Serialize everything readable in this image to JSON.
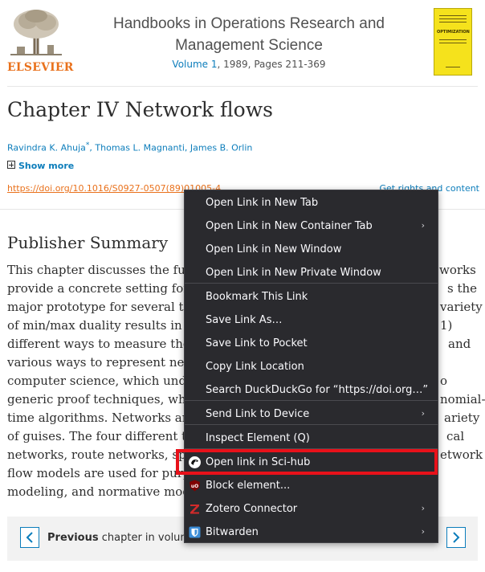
{
  "header": {
    "publisher": "ELSEVIER",
    "journal_line1": "Handbooks in Operations Research and",
    "journal_line2": "Management Science",
    "volume_link": "Volume 1",
    "volume_rest": ", 1989, Pages 211-369",
    "cover_title": "OPTIMIZATION"
  },
  "article": {
    "title": "Chapter IV Network flows",
    "author1": "Ravindra K. Ahuja",
    "author1_mark": "*",
    "authors_rest": ", Thomas L. Magnanti, James B. Orlin",
    "show_more": "Show more",
    "doi": "https://doi.org/10.1016/S0927-0507(89)01005-4",
    "rights": "Get rights and content"
  },
  "summary": {
    "heading": "Publisher Summary",
    "lines_left": [
      "This chapter discusses the fund",
      "provide a concrete setting for te",
      "major prototype for several theo",
      "of min/max duality results in di",
      "different ways to measure the p",
      "various ways to represent netwo",
      "computer science, which under",
      "generic proof techniques, which",
      "time algorithms. Networks arise",
      "of guises. The four different typ",
      "networks, route networks, spac",
      "flow models are used for purpo",
      "modeling, and normative mode"
    ],
    "lines_right": [
      "works",
      "s the",
      "variety",
      "1)",
      "and",
      "",
      "o",
      "nomial-",
      "ariety",
      "cal",
      "etwork",
      "",
      ""
    ]
  },
  "nav": {
    "prev_bold": "Previous",
    "prev_rest": " chapter in volume",
    "next_fragment": "e"
  },
  "context_menu": {
    "items": [
      {
        "label": "Open Link in New Tab",
        "submenu": false
      },
      {
        "label": "Open Link in New Container Tab",
        "submenu": true
      },
      {
        "label": "Open Link in New Window",
        "submenu": false
      },
      {
        "label": "Open Link in New Private Window",
        "submenu": false
      },
      {
        "label": "Bookmark This Link",
        "submenu": false
      },
      {
        "label": "Save Link As…",
        "submenu": false
      },
      {
        "label": "Save Link to Pocket",
        "submenu": false
      },
      {
        "label": "Copy Link Location",
        "submenu": false
      },
      {
        "label": "Search DuckDuckGo for “https://doi.org…”",
        "submenu": false
      },
      {
        "label": "Send Link to Device",
        "submenu": true
      },
      {
        "label": "Inspect Element (Q)",
        "submenu": false
      },
      {
        "label": "Open link in Sci-hub",
        "submenu": false,
        "icon": "sci-hub-raven-icon"
      },
      {
        "label": "Block element...",
        "submenu": false,
        "icon": "ublock-origin-icon"
      },
      {
        "label": "Zotero Connector",
        "submenu": true,
        "icon": "zotero-icon"
      },
      {
        "label": "Bitwarden",
        "submenu": true,
        "icon": "bitwarden-icon"
      }
    ],
    "submenu_arrow": "›",
    "highlighted_item": "Open link in Sci-hub"
  },
  "colors": {
    "link_blue": "#0c7dbb",
    "elsevier_orange": "#e9711c",
    "menu_bg": "#2a2a2e",
    "highlight_red": "#e8111a"
  }
}
